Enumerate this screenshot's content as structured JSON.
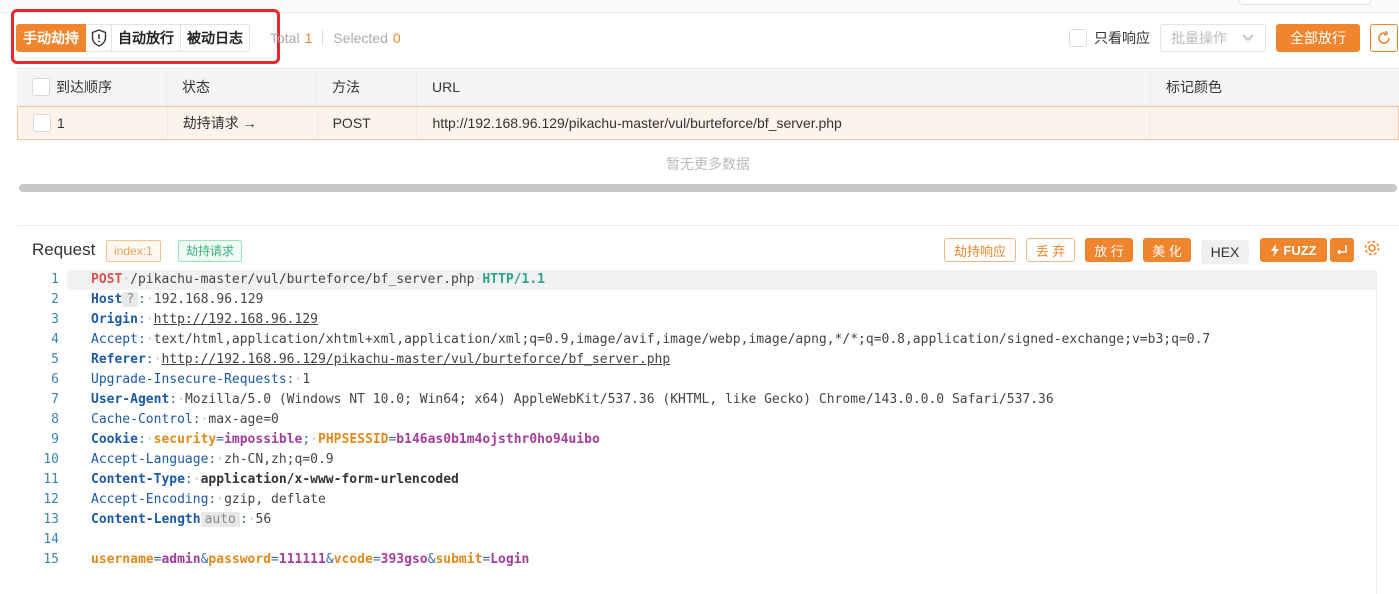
{
  "toolbar": {
    "mode_manual": "手动劫持",
    "mode_auto": "自动放行",
    "mode_passive": "被动日志",
    "total_label": "Total",
    "total_value": "1",
    "selected_label": "Selected",
    "selected_value": "0",
    "only_response_label": "只看响应",
    "batch_label": "批量操作",
    "release_all_label": "全部放行"
  },
  "table": {
    "headers": [
      "到达顺序",
      "状态",
      "方法",
      "URL",
      "标记颜色"
    ],
    "rows": [
      {
        "order": "1",
        "status": "劫持请求 →",
        "method": "POST",
        "url": "http://192.168.96.129/pikachu-master/vul/burteforce/bf_server.php",
        "color": ""
      }
    ],
    "empty_text": "暂无更多数据"
  },
  "request": {
    "title": "Request",
    "index_tag": "index:1",
    "state_tag": "劫持请求",
    "btn_hijack_response": "劫持响应",
    "btn_drop": "丢 弃",
    "btn_release": "放 行",
    "btn_beautify": "美 化",
    "btn_hex": "HEX",
    "btn_fuzz": "FUZZ",
    "line_numbers": [
      "1",
      "2",
      "3",
      "4",
      "5",
      "6",
      "7",
      "8",
      "9",
      "10",
      "11",
      "12",
      "13",
      "14",
      "15"
    ],
    "request_line": {
      "method": "POST",
      "path": "/pikachu-master/vul/burteforce/bf_server.php",
      "protocol": "HTTP/1.1"
    },
    "headers": [
      {
        "name": "Host",
        "value": "192.168.96.129",
        "badge": "?"
      },
      {
        "name": "Origin",
        "value": "http://192.168.96.129"
      },
      {
        "name": "Accept",
        "value": "text/html,application/xhtml+xml,application/xml;q=0.9,image/avif,image/webp,image/apng,*/*;q=0.8,application/signed-exchange;v=b3;q=0.7"
      },
      {
        "name": "Referer",
        "value": "http://192.168.96.129/pikachu-master/vul/burteforce/bf_server.php"
      },
      {
        "name": "Upgrade-Insecure-Requests",
        "value": "1"
      },
      {
        "name": "User-Agent",
        "value": "Mozilla/5.0 (Windows NT 10.0; Win64; x64) AppleWebKit/537.36 (KHTML, like Gecko) Chrome/143.0.0.0 Safari/537.36"
      },
      {
        "name": "Cache-Control",
        "value": "max-age=0"
      },
      {
        "name": "Cookie",
        "cookie_1_key": "security",
        "cookie_1_value": "impossible",
        "cookie_2_key": "PHPSESSID",
        "cookie_2_value": "b146as0b1m4ojsthr0ho94uibo"
      },
      {
        "name": "Accept-Language",
        "value": "zh-CN,zh;q=0.9"
      },
      {
        "name": "Content-Type",
        "value": "application/x-www-form-urlencoded"
      },
      {
        "name": "Accept-Encoding",
        "value": "gzip, deflate"
      },
      {
        "name": "Content-Length",
        "value": "56",
        "badge": "auto"
      }
    ],
    "body": {
      "k1": "username",
      "v1": "admin",
      "k2": "password",
      "v2": "111111",
      "k3": "vcode",
      "v3": "393gso",
      "k4": "submit",
      "v4": "Login"
    }
  },
  "icons": {
    "shield": "shield-icon",
    "chevron": "chevron-down-icon",
    "refresh": "refresh-icon",
    "bolt": "bolt-icon",
    "enter": "enter-icon",
    "gear": "gear-icon"
  },
  "colors": {
    "accent": "#f0852d",
    "highlight_box": "#e8262b",
    "row_bg": "#fdf3ea"
  }
}
